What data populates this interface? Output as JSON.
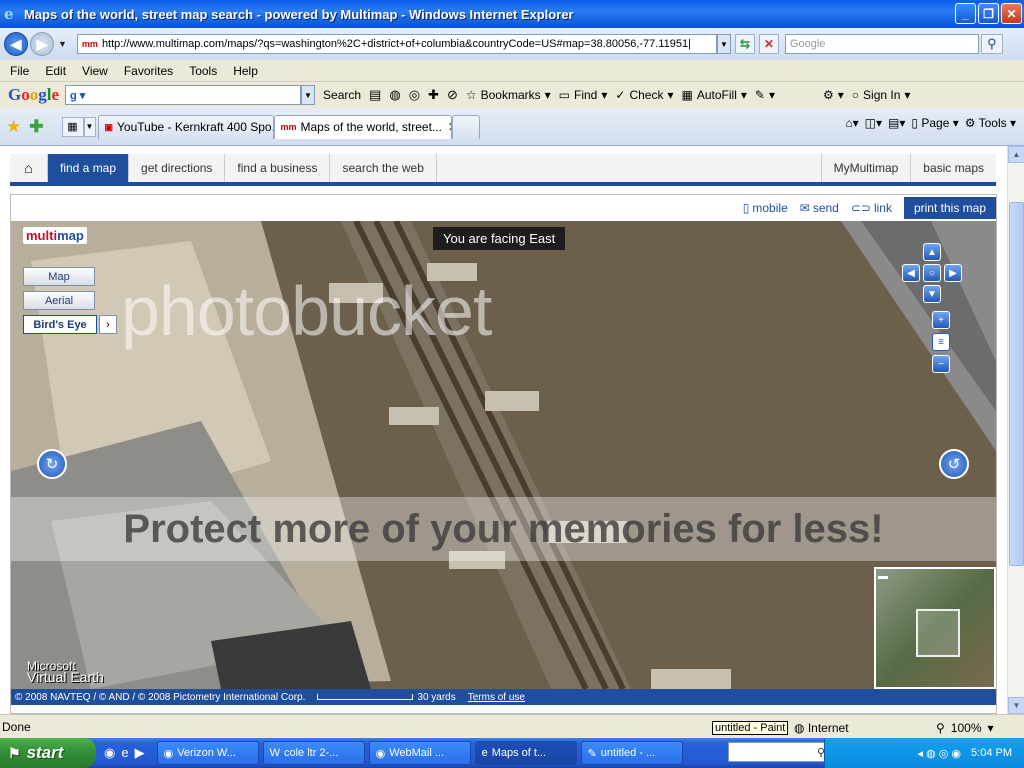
{
  "window": {
    "title": "Maps of the world, street map search - powered by Multimap - Windows Internet Explorer",
    "minimize": "_",
    "maximize": "❐",
    "close": "✕"
  },
  "address": {
    "url": "http://www.multimap.com/maps/?qs=washington%2C+district+of+columbia&countryCode=US#map=38.80056,-77.11951|",
    "search_placeholder": "Google"
  },
  "menu": [
    "File",
    "Edit",
    "View",
    "Favorites",
    "Tools",
    "Help"
  ],
  "googlebar": {
    "search_label": "Search",
    "bookmarks": "Bookmarks",
    "find": "Find",
    "check": "Check",
    "autofill": "AutoFill",
    "signin": "Sign In"
  },
  "tabs": [
    {
      "label": "YouTube - Kernkraft 400 Spo..."
    },
    {
      "label": "Maps of the world, street..."
    }
  ],
  "commandbar": {
    "page": "Page",
    "tools": "Tools"
  },
  "multimap_nav": {
    "items": [
      "find a map",
      "get directions",
      "find a business",
      "search the web"
    ],
    "right_items": [
      "MyMultimap",
      "basic maps"
    ]
  },
  "map_toolbar": {
    "mobile": "mobile",
    "send": "send",
    "link": "link",
    "print": "print this map"
  },
  "map": {
    "logo_left": "multi",
    "logo_right": "map",
    "views": [
      "Map",
      "Aerial",
      "Bird's Eye"
    ],
    "facing": "You are facing East",
    "ve_brand_top": "Microsoft",
    "ve_brand_bottom": "Virtual Earth",
    "copyright": "© 2008 NAVTEQ / © AND / © 2008 Pictometry International Corp.",
    "scale_label": "30 yards",
    "terms": "Terms of use"
  },
  "watermark": {
    "logo": "photobucket",
    "slogan": "Protect more of your memories for less!"
  },
  "status": {
    "text": "Done",
    "tooltip": "untitled - Paint",
    "zone": "Internet",
    "zoom": "100%"
  },
  "taskbar": {
    "start": "start",
    "buttons": [
      "Verizon W...",
      "cole ltr 2-...",
      "WebMail ...",
      "Maps of t...",
      "untitled - ..."
    ],
    "clock": "5:04 PM"
  }
}
